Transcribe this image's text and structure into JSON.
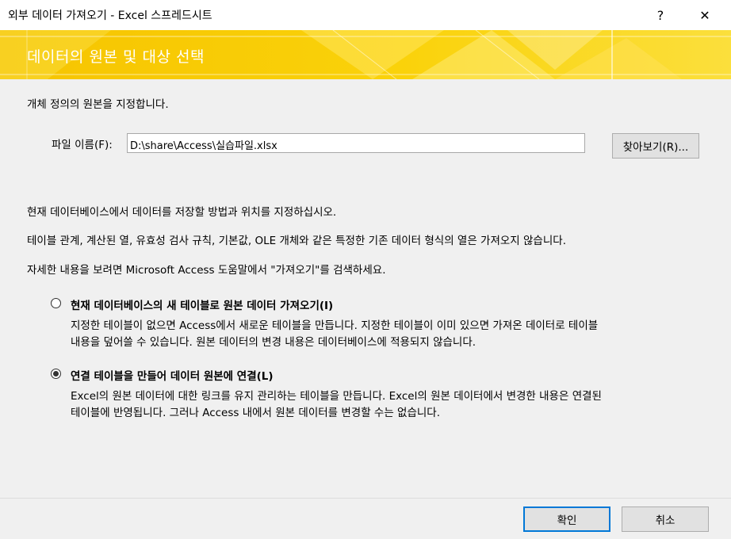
{
  "window": {
    "title": "외부 데이터 가져오기 - Excel 스프레드시트",
    "help_glyph": "?",
    "close_glyph": "✕"
  },
  "banner": {
    "heading": "데이터의 원본 및 대상 선택"
  },
  "source": {
    "intro": "개체 정의의 원본을 지정합니다.",
    "file_label": "파일 이름(F):",
    "file_value": "D:\\share\\Access\\실습파일.xlsx",
    "browse_label": "찾아보기(R)..."
  },
  "info": {
    "line1": "현재 데이터베이스에서 데이터를 저장할 방법과 위치를 지정하십시오.",
    "line2": "테이블 관계, 계산된 열, 유효성 검사 규칙, 기본값, OLE 개체와 같은 특정한 기존 데이터 형식의 열은 가져오지 않습니다.",
    "line3": "자세한 내용을 보려면 Microsoft Access 도움말에서 \"가져오기\"를 검색하세요."
  },
  "options": [
    {
      "label": "현재 데이터베이스의 새 테이블로 원본 데이터 가져오기(I)",
      "desc1": "지정한 테이블이 없으면 Access에서 새로운 테이블을 만듭니다. 지정한 테이블이 이미 있으면 가져온 데이터로 테이블",
      "desc2": "내용을 덮어쓸 수 있습니다. 원본 데이터의 변경 내용은 데이터베이스에 적용되지 않습니다.",
      "selected": false
    },
    {
      "label": "연결 테이블을 만들어 데이터 원본에 연결(L)",
      "desc1": "Excel의 원본 데이터에 대한 링크를 유지 관리하는 테이블을 만듭니다. Excel의 원본 데이터에서 변경한 내용은 연결된",
      "desc2": "테이블에 반영됩니다. 그러나 Access 내에서 원본 데이터를 변경할 수는 없습니다.",
      "selected": true
    }
  ],
  "footer": {
    "ok_label": "확인",
    "cancel_label": "취소"
  },
  "colors": {
    "banner": "#f6c400",
    "default_button_border": "#0078d7"
  }
}
